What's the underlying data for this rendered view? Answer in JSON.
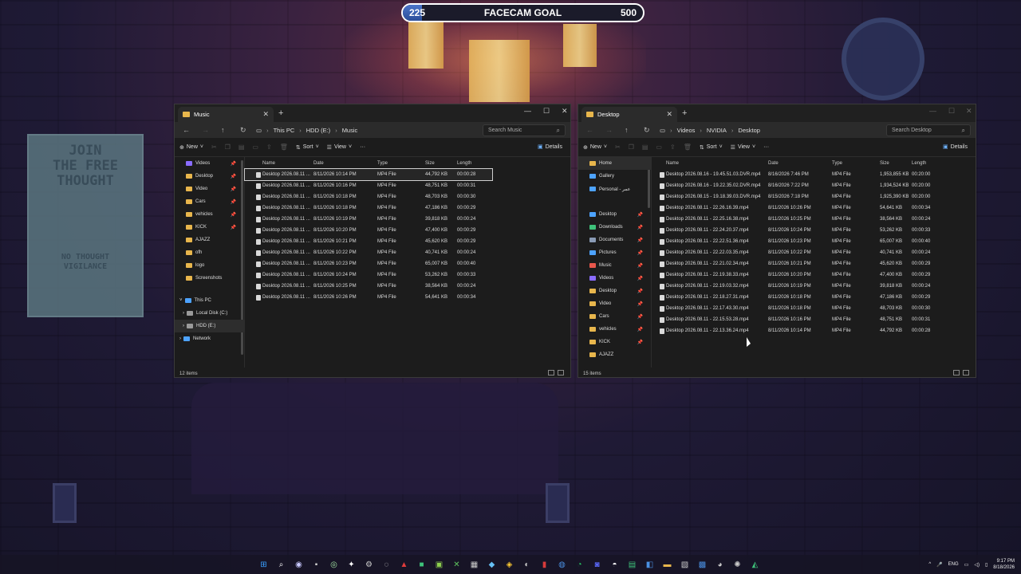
{
  "goal": {
    "start": "225",
    "title": "FACECAM GOAL",
    "end": "500",
    "progress": 0.08
  },
  "poster": {
    "line1": "JOIN",
    "line2": "THE FREE",
    "line3": "THOUGHT",
    "line4": "NO THOUGHT",
    "line5": "VIGILANCE"
  },
  "left_window": {
    "tab_title": "Music",
    "breadcrumb": [
      "This PC",
      "HDD (E:)",
      "Music"
    ],
    "search_placeholder": "Search Music",
    "toolbar": {
      "new": "New",
      "sort": "Sort",
      "view": "View",
      "more": "···",
      "details": "Details"
    },
    "sidebar": [
      {
        "label": "Videos",
        "icon": "videos-icon",
        "color": "#8a6cff",
        "pinned": true
      },
      {
        "label": "Desktop",
        "icon": "folder-icon",
        "color": "#e8b64c",
        "pinned": true
      },
      {
        "label": "Video",
        "icon": "folder-icon",
        "color": "#e8b64c",
        "pinned": true
      },
      {
        "label": "Cars",
        "icon": "folder-icon",
        "color": "#e8b64c",
        "pinned": true
      },
      {
        "label": "vehicles",
        "icon": "folder-icon",
        "color": "#e8b64c",
        "pinned": true
      },
      {
        "label": "KICK",
        "icon": "folder-icon",
        "color": "#e8b64c",
        "pinned": true
      },
      {
        "label": "AJAZZ",
        "icon": "folder-icon",
        "color": "#e8b64c",
        "pinned": false
      },
      {
        "label": "ofh",
        "icon": "folder-icon",
        "color": "#e8b64c",
        "pinned": false
      },
      {
        "label": "logo",
        "icon": "folder-icon",
        "color": "#e8b64c",
        "pinned": false
      },
      {
        "label": "Screenshots",
        "icon": "folder-icon",
        "color": "#e8b64c",
        "pinned": false
      }
    ],
    "tree": [
      {
        "label": "This PC",
        "icon": "pc-icon",
        "color": "#4da3ff",
        "expanded": true
      },
      {
        "label": "Local Disk (C:)",
        "icon": "drive-icon",
        "color": "#9a9a9a"
      },
      {
        "label": "HDD (E:)",
        "icon": "drive-icon",
        "color": "#9a9a9a",
        "selected": true
      },
      {
        "label": "Network",
        "icon": "network-icon",
        "color": "#4da3ff"
      }
    ],
    "columns": [
      "Name",
      "Date",
      "Type",
      "Size",
      "Length"
    ],
    "rows": [
      [
        "Desktop 2026.08.11 ...",
        "8/11/2026 10:14 PM",
        "MP4 File",
        "44,792 KB",
        "00:00:28"
      ],
      [
        "Desktop 2026.08.11 ...",
        "8/11/2026 10:16 PM",
        "MP4 File",
        "48,751 KB",
        "00:00:31"
      ],
      [
        "Desktop 2026.08.11 ...",
        "8/11/2026 10:18 PM",
        "MP4 File",
        "48,703 KB",
        "00:00:30"
      ],
      [
        "Desktop 2026.08.11 ...",
        "8/11/2026 10:18 PM",
        "MP4 File",
        "47,186 KB",
        "00:00:29"
      ],
      [
        "Desktop 2026.08.11 ...",
        "8/11/2026 10:19 PM",
        "MP4 File",
        "39,818 KB",
        "00:00:24"
      ],
      [
        "Desktop 2026.08.11 ...",
        "8/11/2026 10:20 PM",
        "MP4 File",
        "47,400 KB",
        "00:00:29"
      ],
      [
        "Desktop 2026.08.11 ...",
        "8/11/2026 10:21 PM",
        "MP4 File",
        "45,620 KB",
        "00:00:29"
      ],
      [
        "Desktop 2026.08.11 ...",
        "8/11/2026 10:22 PM",
        "MP4 File",
        "40,741 KB",
        "00:00:24"
      ],
      [
        "Desktop 2026.08.11 ...",
        "8/11/2026 10:23 PM",
        "MP4 File",
        "65,007 KB",
        "00:00:40"
      ],
      [
        "Desktop 2026.08.11 ...",
        "8/11/2026 10:24 PM",
        "MP4 File",
        "53,262 KB",
        "00:00:33"
      ],
      [
        "Desktop 2026.08.11 ...",
        "8/11/2026 10:25 PM",
        "MP4 File",
        "38,564 KB",
        "00:00:24"
      ],
      [
        "Desktop 2026.08.11 ...",
        "8/11/2026 10:26 PM",
        "MP4 File",
        "54,641 KB",
        "00:00:34"
      ]
    ],
    "status": "12 items"
  },
  "right_window": {
    "tab_title": "Desktop",
    "breadcrumb": [
      "Videos",
      "NVIDIA",
      "Desktop"
    ],
    "search_placeholder": "Search Desktop",
    "toolbar": {
      "new": "New",
      "sort": "Sort",
      "view": "View",
      "more": "···",
      "details": "Details"
    },
    "sidebar": [
      {
        "label": "Home",
        "icon": "home-icon",
        "color": "#e8b64c",
        "selected": true
      },
      {
        "label": "Gallery",
        "icon": "gallery-icon",
        "color": "#4da3ff"
      },
      {
        "label": "Personal - عمر",
        "icon": "cloud-icon",
        "color": "#4da3ff"
      },
      {
        "label": "",
        "icon": "",
        "color": "transparent"
      },
      {
        "label": "Desktop",
        "icon": "desktop-icon",
        "color": "#4da3ff",
        "pinned": true
      },
      {
        "label": "Downloads",
        "icon": "downloads-icon",
        "color": "#3ec27a",
        "pinned": true
      },
      {
        "label": "Documents",
        "icon": "documents-icon",
        "color": "#8a9bb5",
        "pinned": true
      },
      {
        "label": "Pictures",
        "icon": "pictures-icon",
        "color": "#4da3ff",
        "pinned": true
      },
      {
        "label": "Music",
        "icon": "music-icon",
        "color": "#e8574c",
        "pinned": true
      },
      {
        "label": "Videos",
        "icon": "videos-icon",
        "color": "#8a6cff",
        "pinned": true
      },
      {
        "label": "Desktop",
        "icon": "folder-icon",
        "color": "#e8b64c",
        "pinned": true
      },
      {
        "label": "Video",
        "icon": "folder-icon",
        "color": "#e8b64c",
        "pinned": true
      },
      {
        "label": "Cars",
        "icon": "folder-icon",
        "color": "#e8b64c",
        "pinned": true
      },
      {
        "label": "vehicles",
        "icon": "folder-icon",
        "color": "#e8b64c",
        "pinned": true
      },
      {
        "label": "KICK",
        "icon": "folder-icon",
        "color": "#e8b64c",
        "pinned": true
      },
      {
        "label": "AJAZZ",
        "icon": "folder-icon",
        "color": "#e8b64c"
      }
    ],
    "columns": [
      "Name",
      "Date",
      "Type",
      "Size",
      "Length"
    ],
    "rows": [
      [
        "Desktop 2026.08.16 - 19.45.51.03.DVR.mp4",
        "8/16/2026 7:46 PM",
        "MP4 File",
        "1,953,855 KB",
        "00:20:00"
      ],
      [
        "Desktop 2026.08.16 - 19.22.35.02.DVR.mp4",
        "8/16/2026 7:22 PM",
        "MP4 File",
        "1,934,524 KB",
        "00:20:00"
      ],
      [
        "Desktop 2026.08.15 - 19.18.39.03.DVR.mp4",
        "8/15/2026 7:18 PM",
        "MP4 File",
        "1,925,390 KB",
        "00:20:00"
      ],
      [
        "Desktop 2026.08.11 - 22.26.16.39.mp4",
        "8/11/2026 10:26 PM",
        "MP4 File",
        "54,641 KB",
        "00:00:34"
      ],
      [
        "Desktop 2026.08.11 - 22.25.16.38.mp4",
        "8/11/2026 10:25 PM",
        "MP4 File",
        "38,564 KB",
        "00:00:24"
      ],
      [
        "Desktop 2026.08.11 - 22.24.20.37.mp4",
        "8/11/2026 10:24 PM",
        "MP4 File",
        "53,262 KB",
        "00:00:33"
      ],
      [
        "Desktop 2026.08.11 - 22.22.51.36.mp4",
        "8/11/2026 10:23 PM",
        "MP4 File",
        "65,007 KB",
        "00:00:40"
      ],
      [
        "Desktop 2026.08.11 - 22.22.03.35.mp4",
        "8/11/2026 10:22 PM",
        "MP4 File",
        "40,741 KB",
        "00:00:24"
      ],
      [
        "Desktop 2026.08.11 - 22.21.02.34.mp4",
        "8/11/2026 10:21 PM",
        "MP4 File",
        "45,620 KB",
        "00:00:29"
      ],
      [
        "Desktop 2026.08.11 - 22.19.38.33.mp4",
        "8/11/2026 10:20 PM",
        "MP4 File",
        "47,400 KB",
        "00:00:29"
      ],
      [
        "Desktop 2026.08.11 - 22.19.03.32.mp4",
        "8/11/2026 10:19 PM",
        "MP4 File",
        "39,818 KB",
        "00:00:24"
      ],
      [
        "Desktop 2026.08.11 - 22.18.27.31.mp4",
        "8/11/2026 10:18 PM",
        "MP4 File",
        "47,186 KB",
        "00:00:29"
      ],
      [
        "Desktop 2026.08.11 - 22.17.43.30.mp4",
        "8/11/2026 10:18 PM",
        "MP4 File",
        "48,703 KB",
        "00:00:30"
      ],
      [
        "Desktop 2026.08.11 - 22.15.53.28.mp4",
        "8/11/2026 10:16 PM",
        "MP4 File",
        "48,751 KB",
        "00:00:31"
      ],
      [
        "Desktop 2026.08.11 - 22.13.36.24.mp4",
        "8/11/2026 10:14 PM",
        "MP4 File",
        "44,792 KB",
        "00:00:28"
      ]
    ],
    "status": "15 items"
  },
  "taskbar": {
    "apps": [
      {
        "name": "start-icon",
        "glyph": "⊞",
        "color": "#3aa0ff"
      },
      {
        "name": "search-icon",
        "glyph": "⌕",
        "color": "#ffffff"
      },
      {
        "name": "app-icon-1",
        "glyph": "◉",
        "color": "#c9c9ff"
      },
      {
        "name": "app-icon-2",
        "glyph": "▪",
        "color": "#d0d0d0"
      },
      {
        "name": "app-icon-3",
        "glyph": "◎",
        "color": "#9fe0a0"
      },
      {
        "name": "app-icon-4",
        "glyph": "✦",
        "color": "#ffffff"
      },
      {
        "name": "app-icon-5",
        "glyph": "⚙",
        "color": "#cccccc"
      },
      {
        "name": "app-icon-6",
        "glyph": "◌",
        "color": "#cccccc"
      },
      {
        "name": "app-icon-7",
        "glyph": "▲",
        "color": "#e03c3c"
      },
      {
        "name": "app-icon-8",
        "glyph": "■",
        "color": "#3ec27a"
      },
      {
        "name": "app-icon-9",
        "glyph": "▣",
        "color": "#8fd14f"
      },
      {
        "name": "app-icon-10",
        "glyph": "✕",
        "color": "#5ec45e"
      },
      {
        "name": "app-icon-11",
        "glyph": "▦",
        "color": "#cccccc"
      },
      {
        "name": "app-icon-12",
        "glyph": "◆",
        "color": "#66c0f4"
      },
      {
        "name": "app-icon-13",
        "glyph": "◈",
        "color": "#ffcc33"
      },
      {
        "name": "app-icon-14",
        "glyph": "◐",
        "color": "#cccccc"
      },
      {
        "name": "app-icon-15",
        "glyph": "▮",
        "color": "#d83b3b"
      },
      {
        "name": "app-icon-16",
        "glyph": "◍",
        "color": "#4a90e2"
      },
      {
        "name": "app-icon-17",
        "glyph": "◔",
        "color": "#25d366"
      },
      {
        "name": "app-icon-18",
        "glyph": "◙",
        "color": "#5865f2"
      },
      {
        "name": "app-icon-19",
        "glyph": "◓",
        "color": "#ffffff"
      },
      {
        "name": "app-icon-20",
        "glyph": "▤",
        "color": "#3ec27a"
      },
      {
        "name": "app-icon-21",
        "glyph": "◧",
        "color": "#4a90e2"
      },
      {
        "name": "file-explorer-icon",
        "glyph": "▬",
        "color": "#e8b64c"
      },
      {
        "name": "app-icon-22",
        "glyph": "▧",
        "color": "#cccccc"
      },
      {
        "name": "app-icon-23",
        "glyph": "▩",
        "color": "#4a90e2"
      },
      {
        "name": "app-icon-24",
        "glyph": "◕",
        "color": "#cccccc"
      },
      {
        "name": "app-icon-25",
        "glyph": "✺",
        "color": "#cccccc"
      },
      {
        "name": "app-icon-26",
        "glyph": "◭",
        "color": "#3ec27a"
      }
    ],
    "tray": {
      "chevron": "^",
      "lang": "ENG",
      "time": "9:17 PM",
      "date": "8/18/2026"
    }
  }
}
